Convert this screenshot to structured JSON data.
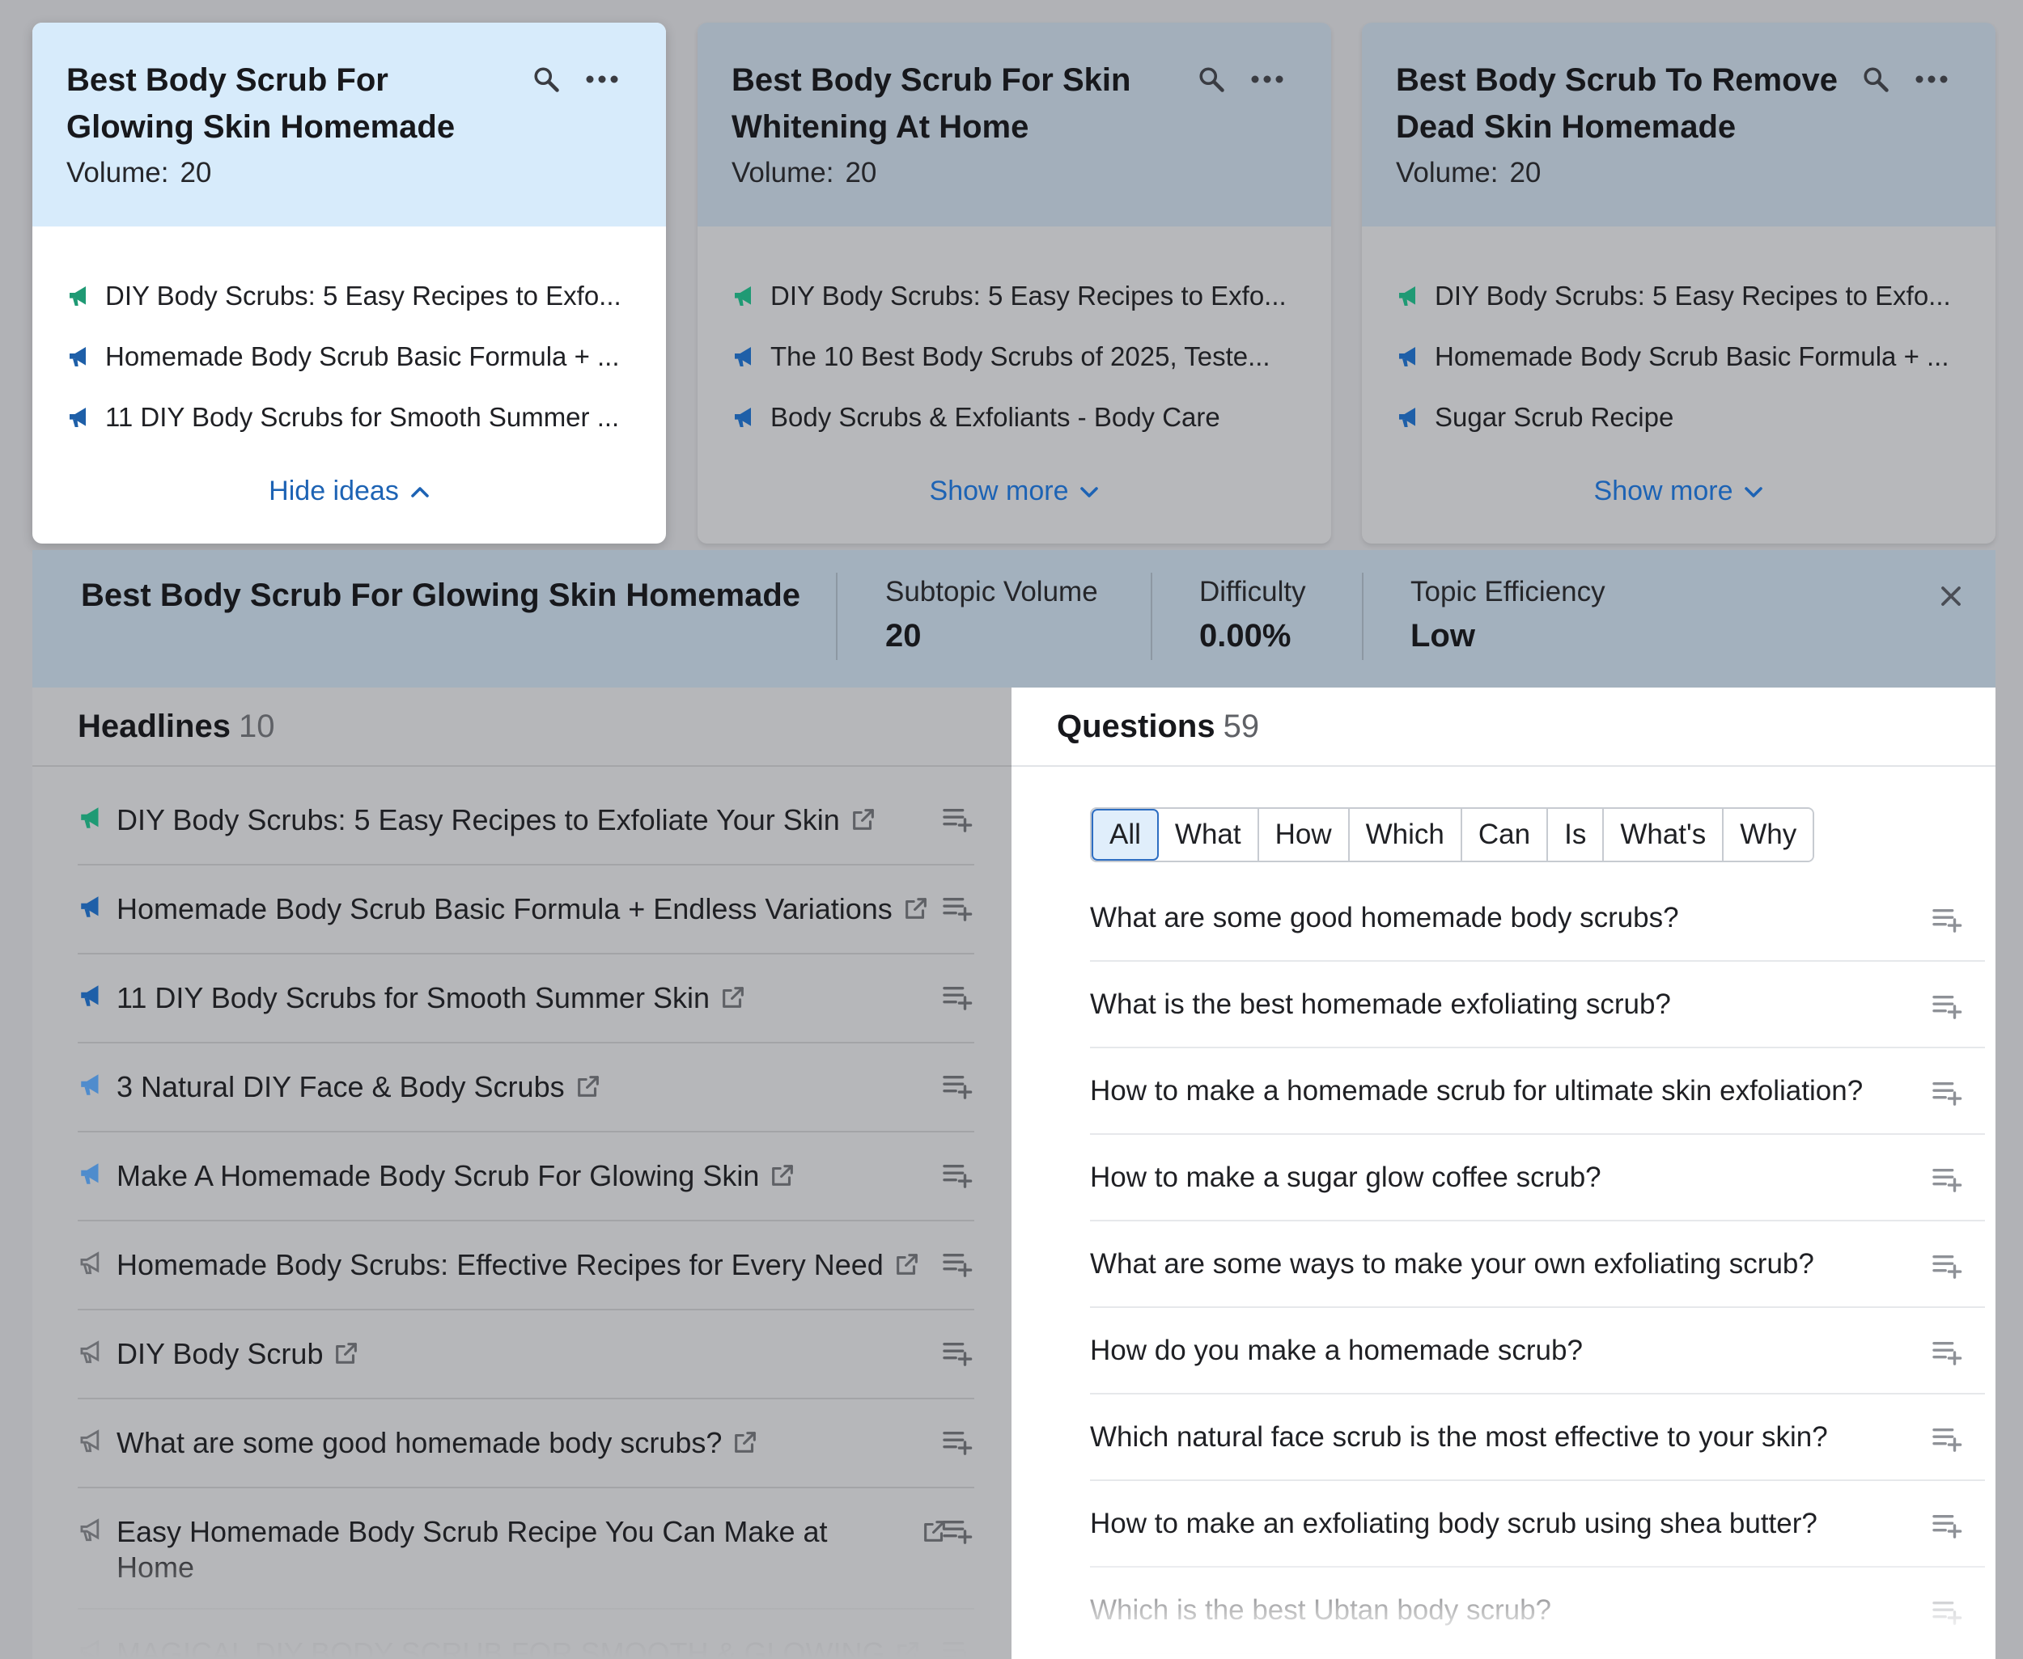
{
  "cards": [
    {
      "title": "Best Body Scrub For Glowing Skin Homemade",
      "volume_label": "Volume:",
      "volume": "20",
      "ideas": [
        {
          "text": "DIY Body Scrubs: 5 Easy Recipes to Exfo...",
          "tier": "green"
        },
        {
          "text": "Homemade Body Scrub Basic Formula + ...",
          "tier": "blue"
        },
        {
          "text": "11 DIY Body Scrubs for Smooth Summer ...",
          "tier": "blue"
        }
      ],
      "toggle_label": "Hide ideas",
      "toggle_state": "expanded"
    },
    {
      "title": "Best Body Scrub For Skin Whitening At Home",
      "volume_label": "Volume:",
      "volume": "20",
      "ideas": [
        {
          "text": "DIY Body Scrubs: 5 Easy Recipes to Exfo...",
          "tier": "green"
        },
        {
          "text": "The 10 Best Body Scrubs of 2025, Teste...",
          "tier": "blue"
        },
        {
          "text": "Body Scrubs & Exfoliants - Body Care",
          "tier": "blue"
        }
      ],
      "toggle_label": "Show more",
      "toggle_state": "collapsed"
    },
    {
      "title": "Best Body Scrub To Remove Dead Skin Homemade",
      "volume_label": "Volume:",
      "volume": "20",
      "ideas": [
        {
          "text": "DIY Body Scrubs: 5 Easy Recipes to Exfo...",
          "tier": "green"
        },
        {
          "text": "Homemade Body Scrub Basic Formula + ...",
          "tier": "blue"
        },
        {
          "text": "Sugar Scrub Recipe",
          "tier": "blue"
        }
      ],
      "toggle_label": "Show more",
      "toggle_state": "collapsed"
    }
  ],
  "panel": {
    "title": "Best Body Scrub For Glowing Skin Homemade",
    "subtopic_volume_label": "Subtopic Volume",
    "subtopic_volume": "20",
    "difficulty_label": "Difficulty",
    "difficulty": "0.00%",
    "efficiency_label": "Topic Efficiency",
    "efficiency": "Low"
  },
  "headlines": {
    "label": "Headlines",
    "count": "10",
    "items": [
      {
        "text": "DIY Body Scrubs: 5 Easy Recipes to Exfoliate Your Skin",
        "tier": "green"
      },
      {
        "text": "Homemade Body Scrub Basic Formula + Endless Variations",
        "tier": "blue"
      },
      {
        "text": "11 DIY Body Scrubs for Smooth Summer Skin",
        "tier": "blue"
      },
      {
        "text": "3 Natural DIY Face & Body Scrubs",
        "tier": "lightblue"
      },
      {
        "text": "Make A Homemade Body Scrub For Glowing Skin",
        "tier": "lightblue"
      },
      {
        "text": "Homemade Body Scrubs: Effective Recipes for Every Need",
        "tier": "gray"
      },
      {
        "text": "DIY Body Scrub",
        "tier": "gray"
      },
      {
        "text": "What are some good homemade body scrubs?",
        "tier": "gray"
      },
      {
        "text": "Easy Homemade Body Scrub Recipe You Can Make at Home",
        "tier": "gray"
      },
      {
        "text": "MAGICAL DIY BODY SCRUB FOR SMOOTH & GLOWING",
        "tier": "gray"
      }
    ]
  },
  "questions": {
    "label": "Questions",
    "count": "59",
    "filters": [
      "All",
      "What",
      "How",
      "Which",
      "Can",
      "Is",
      "What's",
      "Why"
    ],
    "active_filter": "All",
    "items": [
      "What are some good homemade body scrubs?",
      "What is the best homemade exfoliating scrub?",
      "How to make a homemade scrub for ultimate skin exfoliation?",
      "How to make a sugar glow coffee scrub?",
      "What are some ways to make your own exfoliating scrub?",
      "How do you make a homemade scrub?",
      "Which natural face scrub is the most effective to your skin?",
      "How to make an exfoliating body scrub using shea butter?",
      "Which is the best Ubtan body scrub?"
    ]
  },
  "colors": {
    "green": "#1f9a74",
    "blue": "#1e5fa8",
    "lightblue": "#4f8ccd",
    "gray": "#6c6e73",
    "link": "#1d63b4",
    "active_card_head": "#d7ebfb"
  },
  "icons": {
    "search": "search-icon",
    "more": "more-icon",
    "megaphone": "megaphone-icon",
    "external": "external-link-icon",
    "add_to_list": "add-to-list-icon",
    "close": "close-icon",
    "chevron_up": "chevron-up-icon",
    "chevron_down": "chevron-down-icon"
  }
}
